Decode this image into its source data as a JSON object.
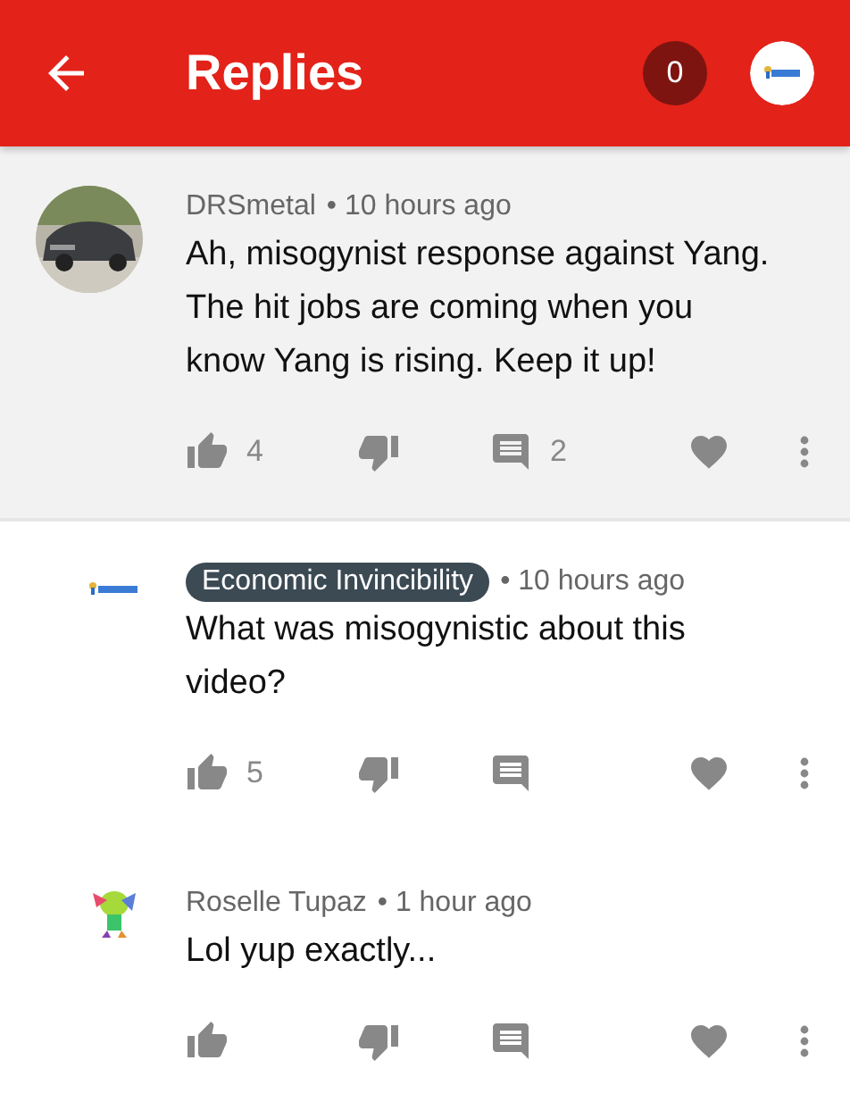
{
  "header": {
    "title": "Replies",
    "badge": "0"
  },
  "comments": [
    {
      "author": {
        "name": "DRSmetal",
        "kind": "plain"
      },
      "time": "• 10 hours ago",
      "text": "Ah, misogynist response against Yang. The hit jobs are coming when you know Yang is rising. Keep it up!",
      "likes": "4",
      "replies": "2",
      "highlighted": true
    },
    {
      "author": {
        "name": "Economic Invincibility",
        "kind": "badge"
      },
      "time": "• 10 hours ago",
      "text": "What was misogynistic about this video?",
      "likes": "5",
      "highlighted": false
    },
    {
      "author": {
        "name": "Roselle Tupaz",
        "kind": "plain"
      },
      "time": "• 1 hour ago",
      "text": "Lol yup exactly...",
      "highlighted": false
    }
  ]
}
